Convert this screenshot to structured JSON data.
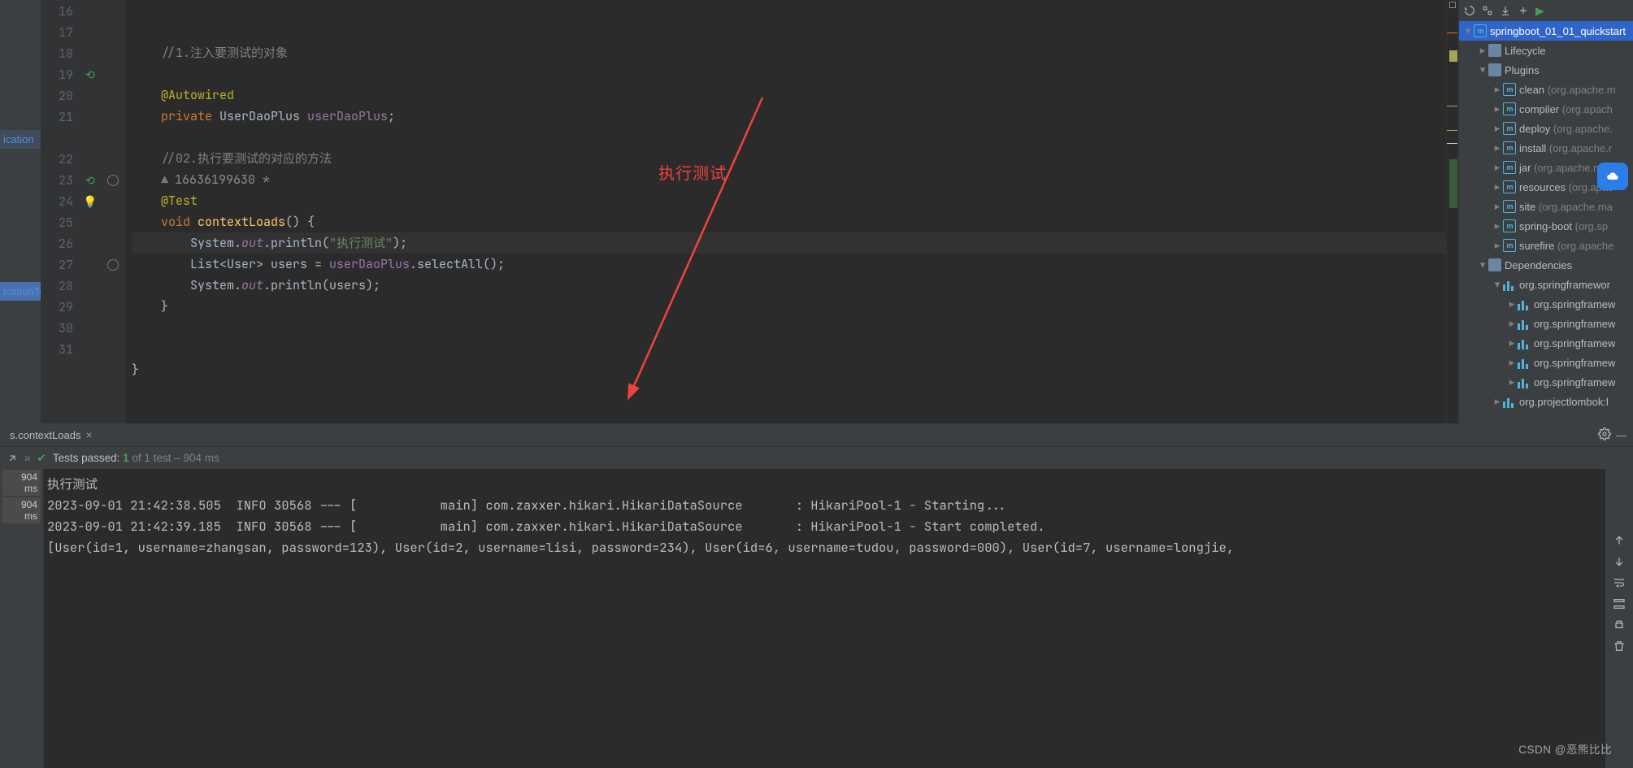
{
  "editor": {
    "line_start": 16,
    "lines": [
      {
        "seg": [
          {
            "cls": "code-cmt",
            "t": "//1.注入要测试的对象"
          }
        ],
        "ind": 1
      },
      {
        "seg": [],
        "ind": 1
      },
      {
        "seg": [
          {
            "cls": "code-anno",
            "t": "@Autowired"
          }
        ],
        "ind": 1
      },
      {
        "seg": [
          {
            "cls": "code-key",
            "t": "private "
          },
          {
            "cls": "code-type",
            "t": "UserDaoPlus "
          },
          {
            "cls": "code-field",
            "t": "userDaoPlus"
          },
          {
            "cls": "",
            "t": ";"
          }
        ],
        "ind": 1
      },
      {
        "seg": [],
        "ind": 1
      },
      {
        "seg": [
          {
            "cls": "code-cmt",
            "t": "//02.执行要测试的对应的方法"
          }
        ],
        "ind": 1
      },
      {
        "author": "16636199630 *"
      },
      {
        "seg": [
          {
            "cls": "code-anno",
            "t": "@Test"
          }
        ],
        "ind": 1
      },
      {
        "seg": [
          {
            "cls": "code-key",
            "t": "void "
          },
          {
            "cls": "code-method",
            "t": "contextLoads"
          },
          {
            "cls": "",
            "t": "() {"
          }
        ],
        "ind": 1
      },
      {
        "hl": true,
        "seg": [
          {
            "cls": "",
            "t": "System."
          },
          {
            "cls": "code-field code-italic",
            "t": "out"
          },
          {
            "cls": "",
            "t": ".println("
          },
          {
            "cls": "code-str",
            "t": "\"执行测试\""
          },
          {
            "cls": "",
            "t": ");"
          }
        ],
        "ind": 2
      },
      {
        "seg": [
          {
            "cls": "",
            "t": "List<User> users = "
          },
          {
            "cls": "code-field",
            "t": "userDaoPlus"
          },
          {
            "cls": "",
            "t": ".selectAll();"
          }
        ],
        "ind": 2
      },
      {
        "seg": [
          {
            "cls": "",
            "t": "System."
          },
          {
            "cls": "code-field code-italic",
            "t": "out"
          },
          {
            "cls": "",
            "t": ".println(users);"
          }
        ],
        "ind": 2
      },
      {
        "seg": [
          {
            "cls": "",
            "t": "}"
          }
        ],
        "ind": 1
      },
      {
        "seg": [],
        "ind": 1
      },
      {
        "seg": [],
        "ind": 1
      },
      {
        "seg": [
          {
            "cls": "",
            "t": "}"
          }
        ],
        "ind": 0
      },
      {
        "seg": [],
        "ind": 0
      }
    ],
    "annotation_label": "执行测试"
  },
  "left": {
    "a": "ication",
    "b": "icationTe"
  },
  "maven": {
    "root": "springboot_01_01_quickstart",
    "lifecycle": "Lifecycle",
    "plugins": "Plugins",
    "plugin_items": [
      {
        "name": "clean",
        "dim": "(org.apache.m"
      },
      {
        "name": "compiler",
        "dim": "(org.apach"
      },
      {
        "name": "deploy",
        "dim": "(org.apache."
      },
      {
        "name": "install",
        "dim": "(org.apache.r"
      },
      {
        "name": "jar",
        "dim": "(org.apache.mav"
      },
      {
        "name": "resources",
        "dim": "(org.apac"
      },
      {
        "name": "site",
        "dim": "(org.apache.ma"
      },
      {
        "name": "spring-boot",
        "dim": "(org.sp"
      },
      {
        "name": "surefire",
        "dim": "(org.apache"
      }
    ],
    "deps": "Dependencies",
    "dep_root": "org.springframewor",
    "dep_items": [
      "org.springframew",
      "org.springframew",
      "org.springframew",
      "org.springframew",
      "org.springframew"
    ],
    "dep_last": "org.projectlombok:l"
  },
  "run": {
    "tab": "s.contextLoads",
    "status_label": "Tests passed:",
    "status_count": "1",
    "status_tail": "of 1 test – 904 ms",
    "chips": [
      "904 ms",
      "904 ms"
    ],
    "console_lines": [
      "执行测试",
      "2023-09-01 21:42:38.505  INFO 30568 --- [           main] com.zaxxer.hikari.HikariDataSource       : HikariPool-1 - Starting...",
      "2023-09-01 21:42:39.185  INFO 30568 --- [           main] com.zaxxer.hikari.HikariDataSource       : HikariPool-1 - Start completed.",
      "[User(id=1, username=zhangsan, password=123), User(id=2, username=lisi, password=234), User(id=6, username=tudou, password=000), User(id=7, username=longjie,"
    ]
  },
  "watermark": "CSDN @恶熊比比"
}
